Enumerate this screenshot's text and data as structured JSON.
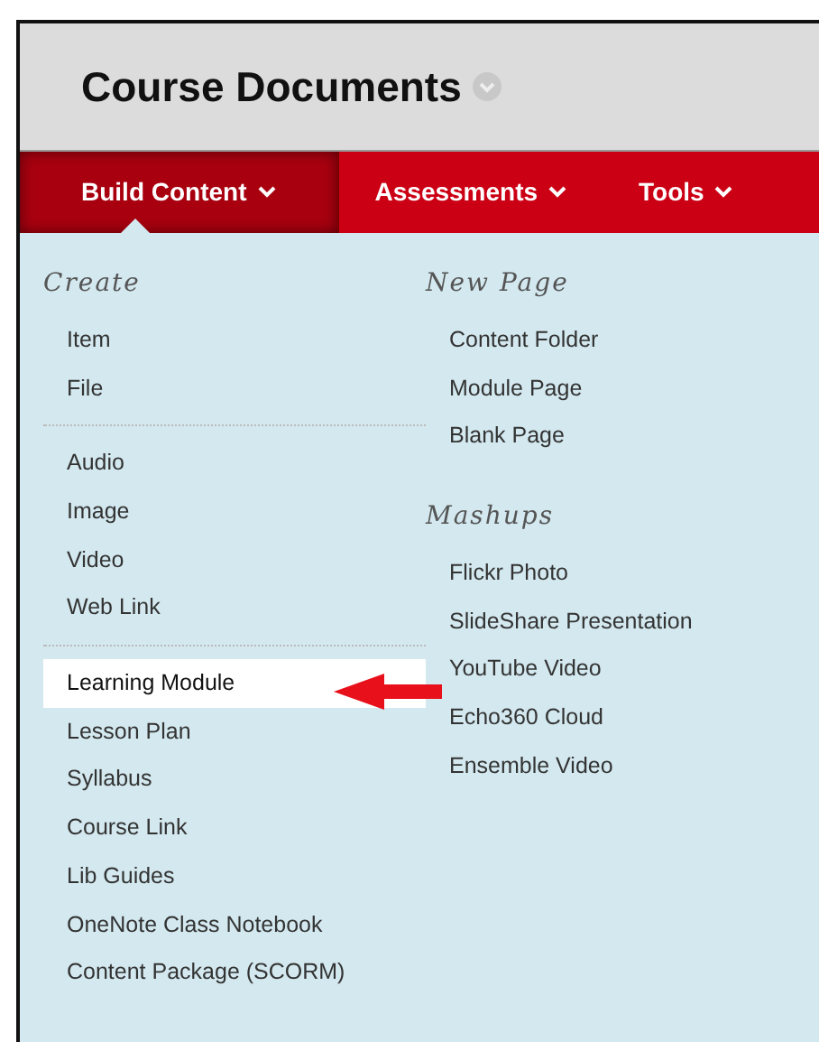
{
  "page_title": "Course Documents",
  "tabs": [
    {
      "label": "Build Content",
      "selected": true
    },
    {
      "label": "Assessments",
      "selected": false
    },
    {
      "label": "Tools",
      "selected": false
    }
  ],
  "menu": {
    "columns": [
      {
        "sections": [
          {
            "heading": "Create",
            "groups": [
              [
                {
                  "label": "Item",
                  "selected": false
                },
                {
                  "label": "File",
                  "selected": false
                }
              ],
              [
                {
                  "label": "Audio",
                  "selected": false
                },
                {
                  "label": "Image",
                  "selected": false
                },
                {
                  "label": "Video",
                  "selected": false
                },
                {
                  "label": "Web Link",
                  "selected": false
                }
              ],
              [
                {
                  "label": "Learning Module",
                  "selected": true
                },
                {
                  "label": "Lesson Plan",
                  "selected": false
                },
                {
                  "label": "Syllabus",
                  "selected": false
                },
                {
                  "label": "Course Link",
                  "selected": false
                },
                {
                  "label": "Lib Guides",
                  "selected": false
                },
                {
                  "label": "OneNote Class Notebook",
                  "selected": false
                },
                {
                  "label": "Content Package (SCORM)",
                  "selected": false
                }
              ]
            ]
          }
        ]
      },
      {
        "sections": [
          {
            "heading": "New Page",
            "groups": [
              [
                {
                  "label": "Content Folder",
                  "selected": false
                },
                {
                  "label": "Module Page",
                  "selected": false
                },
                {
                  "label": "Blank Page",
                  "selected": false
                }
              ]
            ]
          },
          {
            "heading": "Mashups",
            "groups": [
              [
                {
                  "label": "Flickr Photo",
                  "selected": false
                },
                {
                  "label": "SlideShare Presentation",
                  "selected": false
                },
                {
                  "label": "YouTube Video",
                  "selected": false
                },
                {
                  "label": "Echo360 Cloud",
                  "selected": false
                },
                {
                  "label": "Ensemble Video",
                  "selected": false
                }
              ]
            ]
          }
        ]
      }
    ]
  }
}
